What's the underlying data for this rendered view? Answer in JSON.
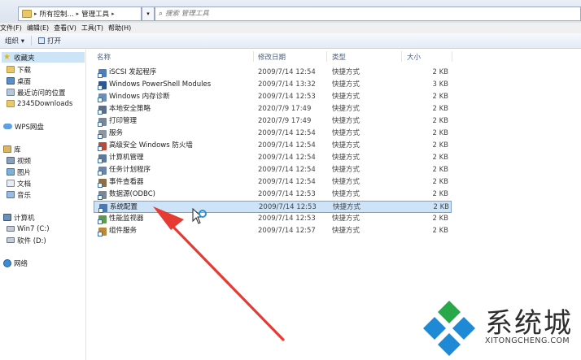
{
  "address": {
    "crumbs": [
      "所有控制...",
      "管理工具"
    ],
    "search_placeholder": "搜索 管理工具"
  },
  "menu": [
    "文件(F)",
    "编辑(E)",
    "查看(V)",
    "工具(T)",
    "帮助(H)"
  ],
  "toolbar": {
    "organize_label": "组织 ▾",
    "open_label": "打开"
  },
  "nav": {
    "favorites": "收藏夹",
    "downloads": "下载",
    "desktop": "桌面",
    "recent": "最近访问的位置",
    "folder2345": "2345Downloads",
    "wps": "WPS网盘",
    "libraries": "库",
    "videos": "视频",
    "pictures": "图片",
    "documents": "文档",
    "music": "音乐",
    "computer": "计算机",
    "win7": "Win7 (C:)",
    "software": "软件 (D:)",
    "network": "网络"
  },
  "columns": {
    "name": "名称",
    "date": "修改日期",
    "type": "类型",
    "size": "大小"
  },
  "files": [
    {
      "name": "iSCSI 发起程序",
      "date": "2009/7/14 12:54",
      "type": "快捷方式",
      "size": "2 KB",
      "icon": "#4f7fb8"
    },
    {
      "name": "Windows PowerShell Modules",
      "date": "2009/7/14 13:32",
      "type": "快捷方式",
      "size": "3 KB",
      "icon": "#2b5797"
    },
    {
      "name": "Windows 内存诊断",
      "date": "2009/7/14 12:53",
      "type": "快捷方式",
      "size": "2 KB",
      "icon": "#6d8fb5"
    },
    {
      "name": "本地安全策略",
      "date": "2020/7/9 17:49",
      "type": "快捷方式",
      "size": "2 KB",
      "icon": "#5a6f8c"
    },
    {
      "name": "打印管理",
      "date": "2020/7/9 17:49",
      "type": "快捷方式",
      "size": "2 KB",
      "icon": "#7a8798"
    },
    {
      "name": "服务",
      "date": "2009/7/14 12:54",
      "type": "快捷方式",
      "size": "2 KB",
      "icon": "#8c97a6"
    },
    {
      "name": "高级安全 Windows 防火墙",
      "date": "2009/7/14 12:54",
      "type": "快捷方式",
      "size": "2 KB",
      "icon": "#b9493c"
    },
    {
      "name": "计算机管理",
      "date": "2009/7/14 12:54",
      "type": "快捷方式",
      "size": "2 KB",
      "icon": "#5d7a9c"
    },
    {
      "name": "任务计划程序",
      "date": "2009/7/14 12:54",
      "type": "快捷方式",
      "size": "2 KB",
      "icon": "#6b86a8"
    },
    {
      "name": "事件查看器",
      "date": "2009/7/14 12:54",
      "type": "快捷方式",
      "size": "2 KB",
      "icon": "#8a6f4a"
    },
    {
      "name": "数据源(ODBC)",
      "date": "2009/7/14 12:53",
      "type": "快捷方式",
      "size": "2 KB",
      "icon": "#7c8796"
    },
    {
      "name": "系统配置",
      "date": "2009/7/14 12:53",
      "type": "快捷方式",
      "size": "2 KB",
      "icon": "#4b7ab0",
      "selected": true
    },
    {
      "name": "性能监视器",
      "date": "2009/7/14 12:53",
      "type": "快捷方式",
      "size": "2 KB",
      "icon": "#5f9a52"
    },
    {
      "name": "组件服务",
      "date": "2009/7/14 12:57",
      "type": "快捷方式",
      "size": "2 KB",
      "icon": "#b98a3a"
    }
  ],
  "watermark": {
    "text": "系统城",
    "sub": "XITONGCHENG.COM"
  },
  "colors": {
    "arrow": "#e53b32",
    "selection": "#cde3f7",
    "logo_blue": "#1e8ad6"
  }
}
